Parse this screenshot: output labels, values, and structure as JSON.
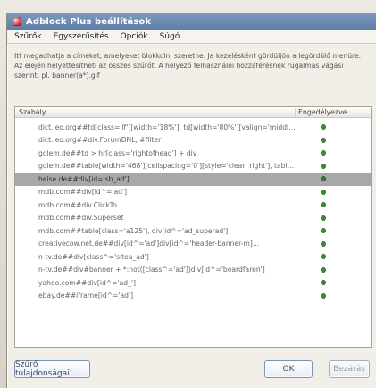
{
  "window": {
    "title": "Adblock Plus beállítások"
  },
  "menu": {
    "items": [
      "Szűrők",
      "Egyszerűsítés",
      "Opciók",
      "Súgó"
    ]
  },
  "description": {
    "text": "Itt megadhatja a címeket, amelyeket blokkolni szeretne. Ja kezelésként gördüljön a legördülő menüre. Az elején helyettesítheti az összes szűrőt. A helyező felhasználói hozzáférésnek rugalmas vágási szerint. pl. banner(a*).gif"
  },
  "list": {
    "header": {
      "filters": "Szabály",
      "state": "Engedélyezve"
    },
    "rows": [
      {
        "filter": "dict.leo.org##td[class='lf'][width='18%'], td[width='80%'][valign='middle']",
        "selected": false
      },
      {
        "filter": "dict.leo.org##div.ForumDNL, #filter",
        "selected": false
      },
      {
        "filter": "golem.de##td > hr[class='rightofhead'] + div",
        "selected": false
      },
      {
        "filter": "golem.de##table[width='468'][cellspacing='0'][style='clear: right'], table...",
        "selected": false
      },
      {
        "filter": "heise.de##div[id='sb_ad']",
        "selected": true
      },
      {
        "filter": "mdb.com##div[id^='ad']",
        "selected": false
      },
      {
        "filter": "mdb.com##div.ClickTo",
        "selected": false
      },
      {
        "filter": "mdb.com##div.Superset",
        "selected": false
      },
      {
        "filter": "mdb.com##table[class='a125'], div[id^='ad_superad']",
        "selected": false
      },
      {
        "filter": "creativecow.net.de##div[id^='ad']div[id^='header-banner-m]...",
        "selected": false
      },
      {
        "filter": "n-tv.de##div[class^='sitea_ad']",
        "selected": false
      },
      {
        "filter": "n-tv.de##div#banner + *:not([class^='ad'])div[id^='boardfaren']",
        "selected": false
      },
      {
        "filter": "yahoo.com##div[id^='ad_']",
        "selected": false
      },
      {
        "filter": "ebay.de##iframe[id^='ad']",
        "selected": false
      }
    ]
  },
  "buttons": {
    "left": "Szűrő tulajdonságai...",
    "ok": "OK",
    "cancel": "Bezárás"
  }
}
